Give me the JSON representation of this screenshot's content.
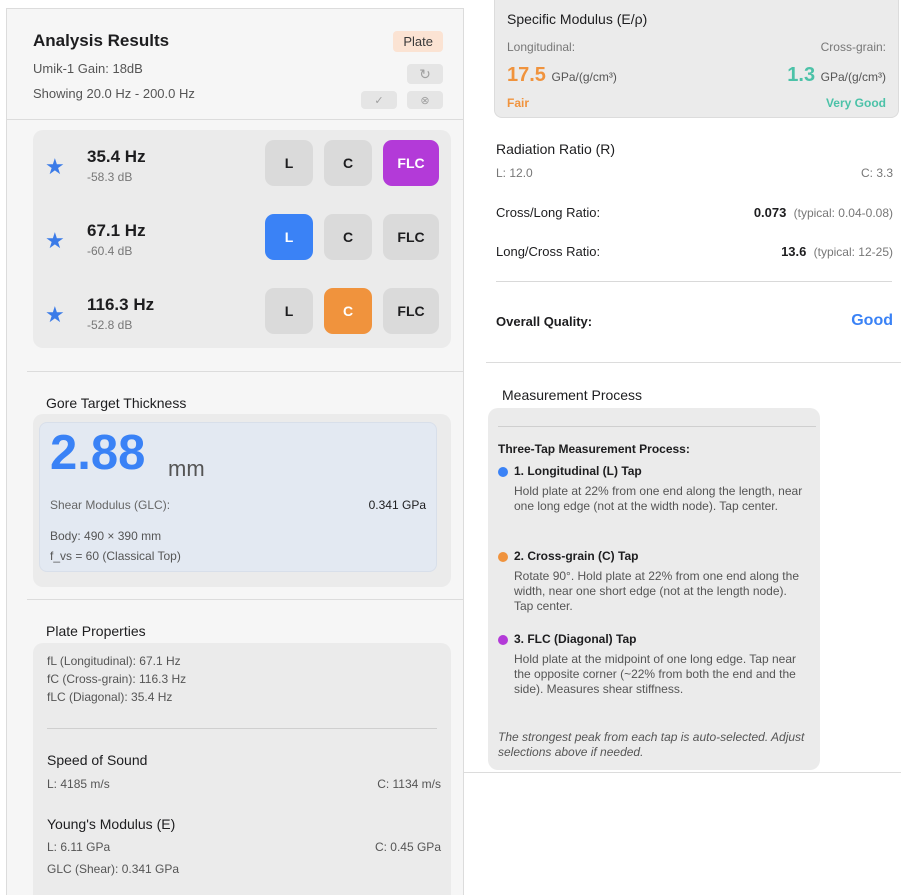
{
  "left": {
    "title": "Analysis Results",
    "badge": "Plate",
    "device_line": "Umik-1  Gain: 18dB",
    "range_line": "Showing 20.0 Hz - 200.0 Hz",
    "icons": {
      "refresh": "↻",
      "check": "✓",
      "x": "⊗"
    },
    "peaks": [
      {
        "freq": "35.4 Hz",
        "db": "-58.3 dB",
        "selected": "FLC"
      },
      {
        "freq": "67.1 Hz",
        "db": "-60.4 dB",
        "selected": "L"
      },
      {
        "freq": "116.3 Hz",
        "db": "-52.8 dB",
        "selected": "C"
      }
    ],
    "btn_labels": {
      "l": "L",
      "c": "C",
      "f": "FLC"
    },
    "gore": {
      "header": "Gore Target Thickness",
      "value": "2.88",
      "unit": "mm",
      "shear_label": "Shear Modulus (GLC):",
      "shear_value": "0.341 GPa",
      "body": "Body: 490 × 390 mm",
      "fvs": "f_vs = 60 (Classical Top)"
    },
    "props": {
      "header": "Plate Properties",
      "fl": "fL (Longitudinal): 67.1 Hz",
      "fc": "fC (Cross-grain): 116.3 Hz",
      "flc": "fLC (Diagonal): 35.4 Hz",
      "sos_title": "Speed of Sound",
      "sos_l": "L: 4185 m/s",
      "sos_c": "C: 1134 m/s",
      "ym_title": "Young's Modulus (E)",
      "ym_l": "L: 6.11 GPa",
      "ym_c": "C: 0.45 GPa",
      "glc": "GLC (Shear): 0.341 GPa"
    }
  },
  "right": {
    "specific": {
      "title": "Specific Modulus (E/ρ)",
      "long_label": "Longitudinal:",
      "cross_label": "Cross-grain:",
      "long_value": "17.5",
      "cross_value": "1.3",
      "unit": "GPa/(g/cm³)",
      "long_quality": "Fair",
      "cross_quality": "Very Good"
    },
    "radiation": {
      "title": "Radiation Ratio (R)",
      "l": "L: 12.0",
      "c": "C: 3.3"
    },
    "cross_long": {
      "label": "Cross/Long Ratio:",
      "value": "0.073",
      "typical": "(typical: 0.04-0.08)"
    },
    "long_cross": {
      "label": "Long/Cross Ratio:",
      "value": "13.6",
      "typical": "(typical: 12-25)"
    },
    "overall": {
      "label": "Overall Quality:",
      "value": "Good"
    },
    "process": {
      "header": "Measurement Process",
      "title": "Three-Tap Measurement Process:",
      "steps": [
        {
          "title": "1. Longitudinal (L) Tap",
          "body": "Hold plate at 22% from one end along the length, near one long edge (not at the width node). Tap center."
        },
        {
          "title": "2. Cross-grain (C) Tap",
          "body": "Rotate 90°. Hold plate at 22% from one end along the width, near one short edge (not at the length node). Tap center."
        },
        {
          "title": "3. FLC (Diagonal) Tap",
          "body": "Hold plate at the midpoint of one long edge. Tap near the opposite corner (~22% from both the end and the side). Measures shear stiffness."
        }
      ],
      "note": "The strongest peak from each tap is auto-selected. Adjust selections above if needed."
    }
  },
  "colors": {
    "blue": "#3a82f6",
    "orange": "#f0933d",
    "purple": "#b33ad8",
    "teal": "#4cc2a8",
    "long_accent": "#f0933d"
  }
}
